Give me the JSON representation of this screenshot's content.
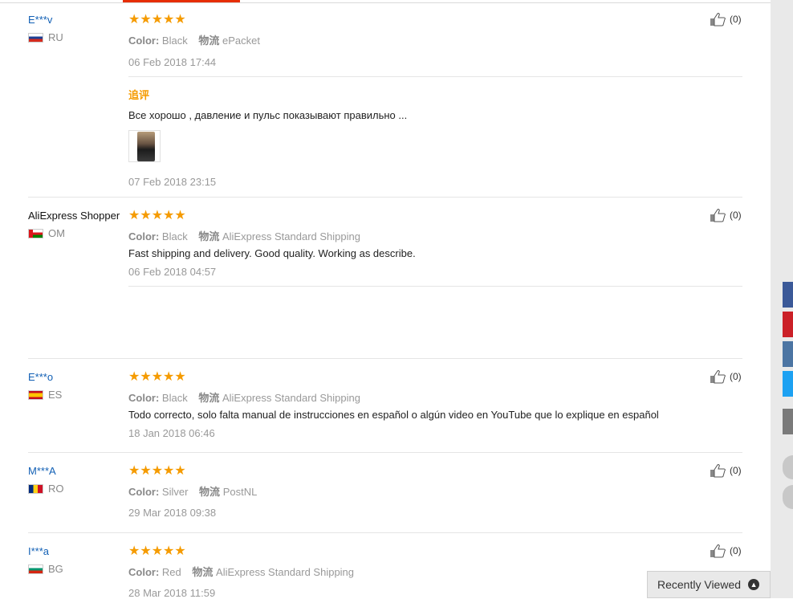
{
  "reviews": [
    {
      "user": "E***v",
      "country": "RU",
      "stars": "★★★★★",
      "color_label": "Color:",
      "color": "Black",
      "ship_label": "物流",
      "shipping": "ePacket",
      "date": "06 Feb 2018 17:44",
      "likes": "(0)",
      "append_title": "追评",
      "append_text": "Все хорошо , давление и пульс показывают правильно ...",
      "append_date": "07 Feb 2018 23:15"
    },
    {
      "user": "AliExpress Shopper",
      "country": "OM",
      "stars": "★★★★★",
      "color_label": "Color:",
      "color": "Black",
      "ship_label": "物流",
      "shipping": "AliExpress Standard Shipping",
      "text": "Fast shipping and delivery. Good quality. Working as describe.",
      "date": "06 Feb 2018 04:57",
      "likes": "(0)"
    },
    {
      "user": "E***o",
      "country": "ES",
      "stars": "★★★★★",
      "color_label": "Color:",
      "color": "Black",
      "ship_label": "物流",
      "shipping": "AliExpress Standard Shipping",
      "text": "Todo correcto, solo falta manual de instrucciones en español o algún video en YouTube que lo explique en español",
      "date": "18 Jan 2018 06:46",
      "likes": "(0)"
    },
    {
      "user": "M***A",
      "country": "RO",
      "stars": "★★★★★",
      "color_label": "Color:",
      "color": "Silver",
      "ship_label": "物流",
      "shipping": "PostNL",
      "date": "29 Mar 2018 09:38",
      "likes": "(0)"
    },
    {
      "user": "I***a",
      "country": "BG",
      "stars": "★★★★★",
      "color_label": "Color:",
      "color": "Red",
      "ship_label": "物流",
      "shipping": "AliExpress Standard Shipping",
      "date": "28 Mar 2018 11:59",
      "likes": "(0)"
    }
  ],
  "recently_viewed": "Recently Viewed",
  "colors": {
    "star": "#f59b00",
    "link": "#1260b5",
    "accent": "#e62e04"
  },
  "social": [
    "facebook",
    "pinterest",
    "vk",
    "twitter"
  ]
}
